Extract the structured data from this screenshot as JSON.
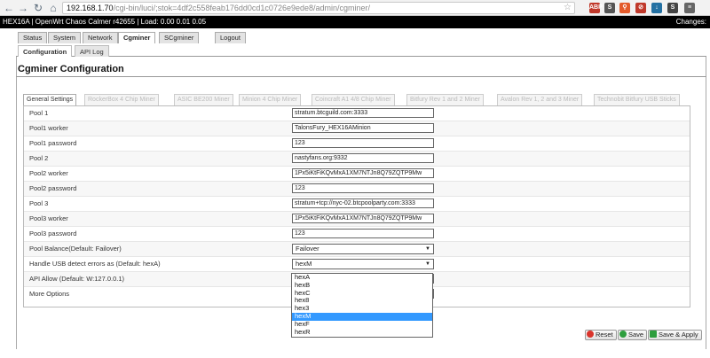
{
  "browser": {
    "url_host": "192.168.1.70",
    "url_path": "/cgi-bin/luci/;stok=4df2c558feab176dd0cd1c0726e9ede8/admin/cgminer/",
    "extensions": [
      {
        "name": "adblock-icon",
        "label": "ABP",
        "color": "#c0392b"
      },
      {
        "name": "s-extension-icon",
        "label": "S",
        "color": "#555555"
      },
      {
        "name": "search-extension-icon",
        "label": "⚲",
        "color": "#e35a2a"
      },
      {
        "name": "stop-extension-icon",
        "label": "⊘",
        "color": "#c0392b"
      },
      {
        "name": "download-extension-icon",
        "label": "↓",
        "color": "#2471a3"
      },
      {
        "name": "s2-extension-icon",
        "label": "S",
        "color": "#444444"
      },
      {
        "name": "menu-icon",
        "label": "≡",
        "color": "#666666"
      }
    ]
  },
  "header": {
    "text": "HEX16A | OpenWrt Chaos Calmer r42655 | Load: 0.00 0.01 0.05",
    "changes": "Changes:"
  },
  "menu": {
    "tabs": [
      "Status",
      "System",
      "Network",
      "Cgminer",
      "SCgminer",
      "Logout"
    ],
    "active": "Cgminer"
  },
  "submenu": {
    "tabs": [
      "Configuration",
      "API Log"
    ],
    "active": "Configuration"
  },
  "page": {
    "title": "Cgminer Configuration"
  },
  "section_tabs": [
    "General Settings",
    "RockerBox 4 Chip Miner",
    "ASIC BE200 Miner",
    "Minion 4 Chip Miner",
    "Coincraft A1 4/8 Chip Miner",
    "Bitfury Rev 1 and 2 Miner",
    "Avalon Rev 1, 2 and 3 Miner",
    "Technobit Bitfury USB Sticks"
  ],
  "form": {
    "pool1_label": "Pool 1",
    "pool1_value": "stratum.btcguild.com:3333",
    "pool1_worker_label": "Pool1 worker",
    "pool1_worker_value": "TalonsFury_HEX16AMinion",
    "pool1_password_label": "Pool1 password",
    "pool1_password_value": "123",
    "pool2_label": "Pool 2",
    "pool2_value": "nastyfans.org:9332",
    "pool2_worker_label": "Pool2 worker",
    "pool2_worker_value": "1Px5iKtFiKQvMxA1XM7NTJn8Q79ZQTP9Mw",
    "pool2_password_label": "Pool2 password",
    "pool2_password_value": "123",
    "pool3_label": "Pool 3",
    "pool3_value": "stratum+tcp://nyc-02.btcpoolparty.com:3333",
    "pool3_worker_label": "Pool3 worker",
    "pool3_worker_value": "1Px5iKtFiKQvMxA1XM7NTJn8Q79ZQTP9Mw",
    "pool3_password_label": "Pool3 password",
    "pool3_password_value": "123",
    "balance_label": "Pool Balance(Default: Failover)",
    "balance_value": "Failover",
    "usb_label": "Handle USB detect errors as (Default: hexA)",
    "usb_value": "hexM",
    "api_allow_label": "API Allow (Default: W:127.0.0.1)",
    "more_options_label": "More Options"
  },
  "dropdown": {
    "options": [
      "hexA",
      "hexB",
      "hexC",
      "hex8",
      "hex3",
      "hexM",
      "hexF",
      "hexR"
    ],
    "selected": "hexM"
  },
  "buttons": {
    "reset": "Reset",
    "save": "Save",
    "save_apply": "Save & Apply"
  }
}
